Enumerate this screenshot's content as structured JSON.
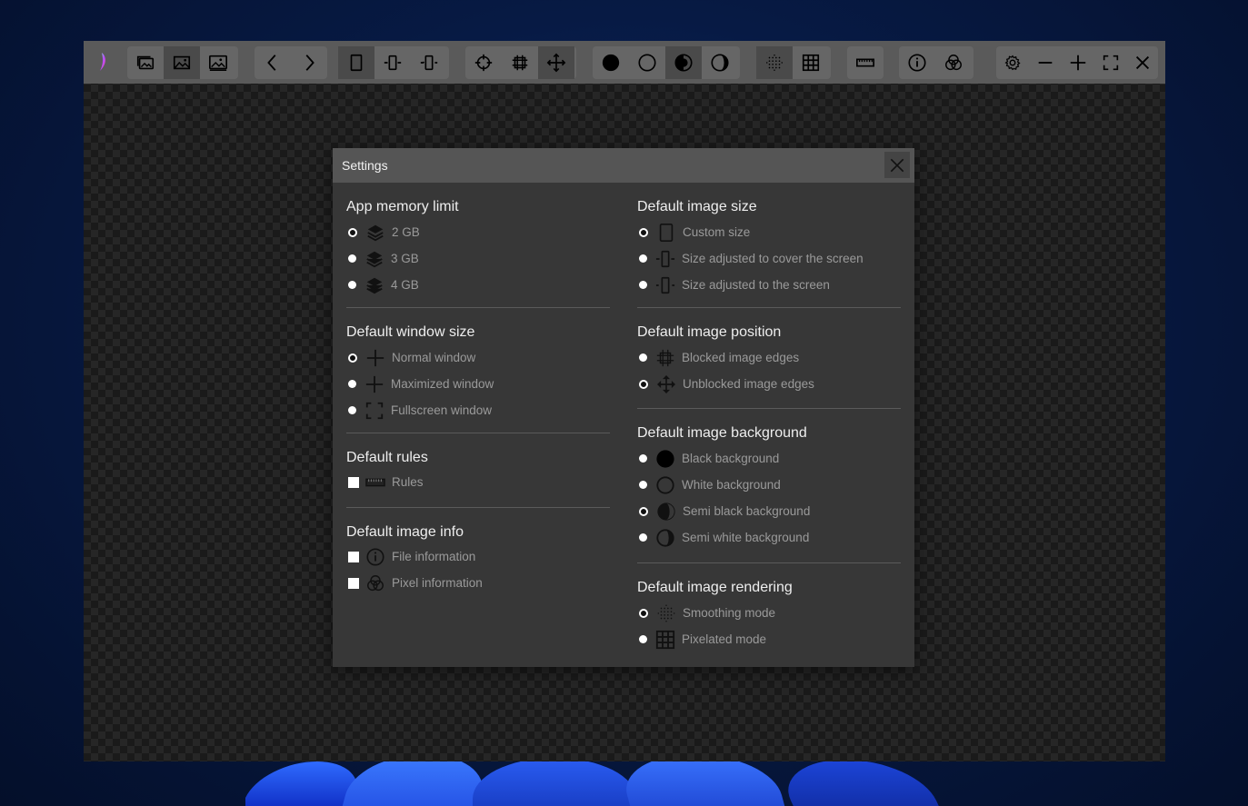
{
  "colors": {
    "desktop": "#071a44",
    "toolbar": "#5a5a5a",
    "toolbar_group": "#666666",
    "toolbar_active": "#4a4a4a",
    "dialog": "#373737",
    "dialog_header": "#555555"
  },
  "dialog": {
    "title": "Settings",
    "close_icon": "close-icon"
  },
  "settings": {
    "memory": {
      "title": "App memory limit",
      "options": [
        {
          "label": "2 GB",
          "icon": "layers-icon",
          "checked": true
        },
        {
          "label": "3 GB",
          "icon": "layers-icon",
          "checked": false
        },
        {
          "label": "4 GB",
          "icon": "layers-icon",
          "checked": false
        }
      ]
    },
    "window_size": {
      "title": "Default window size",
      "options": [
        {
          "label": "Normal window",
          "icon": "plus-icon",
          "checked": true
        },
        {
          "label": "Maximized window",
          "icon": "plus-icon",
          "checked": false
        },
        {
          "label": "Fullscreen window",
          "icon": "fullscreen-icon",
          "checked": false
        }
      ]
    },
    "rules": {
      "title": "Default rules",
      "options": [
        {
          "label": "Rules",
          "icon": "ruler-icon",
          "checked": false
        }
      ]
    },
    "image_info": {
      "title": "Default image info",
      "options": [
        {
          "label": "File information",
          "icon": "info-icon",
          "checked": false
        },
        {
          "label": "Pixel information",
          "icon": "color-circles-icon",
          "checked": false
        }
      ]
    },
    "image_size": {
      "title": "Default image size",
      "options": [
        {
          "label": "Custom size",
          "icon": "rectangle-icon",
          "checked": true
        },
        {
          "label": "Size adjusted to cover the screen",
          "icon": "fit-cover-icon",
          "checked": false
        },
        {
          "label": "Size adjusted to the screen",
          "icon": "fit-screen-icon",
          "checked": false
        }
      ]
    },
    "image_position": {
      "title": "Default image position",
      "options": [
        {
          "label": "Blocked image edges",
          "icon": "blocked-edges-icon",
          "checked": false
        },
        {
          "label": "Unblocked image edges",
          "icon": "move-icon",
          "checked": true
        }
      ]
    },
    "image_background": {
      "title": "Default image background",
      "options": [
        {
          "label": "Black background",
          "icon": "black-circle-icon",
          "checked": false
        },
        {
          "label": "White background",
          "icon": "white-circle-icon",
          "checked": false
        },
        {
          "label": "Semi black background",
          "icon": "semi-black-icon",
          "checked": true
        },
        {
          "label": "Semi white background",
          "icon": "semi-white-icon",
          "checked": false
        }
      ]
    },
    "image_rendering": {
      "title": "Default image rendering",
      "options": [
        {
          "label": "Smoothing mode",
          "icon": "dots-grid-icon",
          "checked": true
        },
        {
          "label": "Pixelated mode",
          "icon": "grid-icon",
          "checked": false
        }
      ]
    }
  },
  "toolbar": {
    "logo": "app-logo",
    "groups": [
      {
        "name": "image-files",
        "buttons": [
          {
            "icon": "gallery-icon",
            "active": false
          },
          {
            "icon": "image-icon",
            "active": true
          },
          {
            "icon": "image-frame-icon",
            "active": false
          }
        ]
      },
      {
        "name": "navigation",
        "buttons": [
          {
            "icon": "chevron-left-icon",
            "active": false
          },
          {
            "icon": "chevron-right-icon",
            "active": false
          }
        ]
      },
      {
        "name": "image-size",
        "buttons": [
          {
            "icon": "rectangle-icon",
            "active": true
          },
          {
            "icon": "fit-cover-icon",
            "active": false
          },
          {
            "icon": "fit-screen-icon",
            "active": false
          }
        ]
      },
      {
        "name": "image-position",
        "buttons": [
          {
            "icon": "crosshair-icon",
            "active": false
          },
          {
            "icon": "blocked-edges-icon",
            "active": false
          },
          {
            "icon": "move-icon",
            "active": true
          }
        ]
      },
      {
        "name": "background",
        "buttons": [
          {
            "icon": "black-circle-icon",
            "active": false
          },
          {
            "icon": "white-circle-icon",
            "active": false
          },
          {
            "icon": "semi-black-icon",
            "active": true
          },
          {
            "icon": "semi-white-icon",
            "active": false
          }
        ]
      },
      {
        "name": "rendering",
        "buttons": [
          {
            "icon": "dots-grid-icon",
            "active": true
          },
          {
            "icon": "grid-icon",
            "active": false
          }
        ]
      },
      {
        "name": "rules",
        "buttons": [
          {
            "icon": "ruler-icon",
            "active": false
          }
        ]
      },
      {
        "name": "info",
        "buttons": [
          {
            "icon": "info-icon",
            "active": false
          },
          {
            "icon": "color-circles-icon",
            "active": false
          }
        ]
      },
      {
        "name": "window",
        "buttons": [
          {
            "icon": "gear-icon",
            "active": false
          },
          {
            "icon": "minimize-icon",
            "active": false
          },
          {
            "icon": "plus-icon",
            "active": false
          },
          {
            "icon": "fullscreen-icon",
            "active": false
          },
          {
            "icon": "close-icon",
            "active": false
          }
        ]
      }
    ]
  }
}
